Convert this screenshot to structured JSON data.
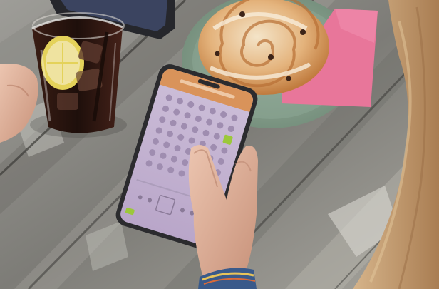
{
  "scene": {
    "description_free": true,
    "palette": {
      "table_wood": "#8a8a86",
      "table_light": "#b9b8b2",
      "plate_green": "#7f9a86",
      "napkin_pink": "#e8769a",
      "pastry": "#e3b88a",
      "drink_dark": "#2a1612",
      "lemon": "#e6d65a",
      "phone_body": "#2b2b2e",
      "phone_screen": "#c9b8d6",
      "phone_header": "#d9935a",
      "highlight_green": "#9cc83a",
      "skin": "#e2b6a0",
      "hair": "#c89c6c",
      "bracelet": "#3a5a8a"
    },
    "phone_grid": {
      "rows": 7,
      "cols": 7,
      "highlight_cell": {
        "row": 2,
        "col": 6
      }
    }
  }
}
